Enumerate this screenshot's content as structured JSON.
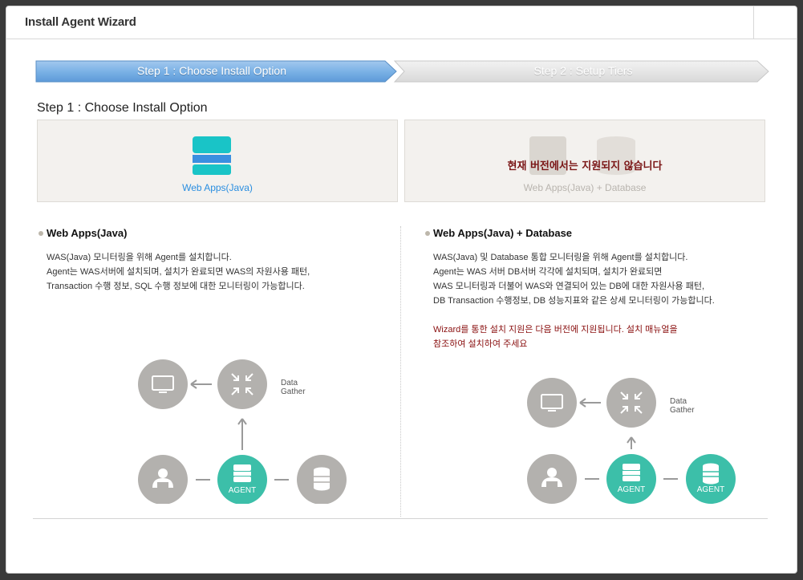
{
  "window": {
    "title": "Install Agent Wizard"
  },
  "steps": [
    {
      "label": "Step 1 : Choose Install Option",
      "state": "active"
    },
    {
      "label": "Step 2 : Setup Tiers",
      "state": "inactive"
    }
  ],
  "section_title": "Step 1 : Choose Install Option",
  "options": [
    {
      "caption": "Web Apps(Java)",
      "icon": "server-stack-icon",
      "selected": true
    },
    {
      "caption": "Web Apps(Java)  + Database",
      "icon": "server-and-database-icon",
      "disabled_message": "현재 버전에서는 지원되지 않습니다"
    }
  ],
  "details": [
    {
      "heading": "Web Apps(Java)",
      "lines": [
        "WAS(Java) 모니터링을 위해 Agent를 설치합니다.",
        "Agent는 WAS서버에 설치되며, 설치가 완료되면 WAS의 자원사용 패턴,",
        "Transaction 수행 정보, SQL 수행 정보에 대한 모니터링이 가능합니다."
      ],
      "diagram": {
        "data_gather": [
          "Data",
          "Gather"
        ],
        "agent": "AGENT"
      }
    },
    {
      "heading": "Web Apps(Java) + Database",
      "lines": [
        "WAS(Java) 및 Database 통합 모니터링을 위해 Agent를 설치합니다.",
        "Agent는 WAS 서버 DB서버 각각에 설치되며, 설치가 완료되면",
        "WAS 모니터링과 더불어 WAS와 연결되어 있는 DB에 대한 자원사용 패턴,",
        "DB Transaction 수행정보, DB 성능지표와 같은 상세 모니터링이 가능합니다."
      ],
      "note": [
        "Wizard를 통한 설치 지원은 다음 버전에 지원됩니다. 설치 매뉴얼을",
        "참조하여 설치하여 주세요"
      ],
      "diagram": {
        "data_gather": [
          "Data",
          "Gather"
        ],
        "agent": "AGENT",
        "agent_db": "AGENT"
      }
    }
  ],
  "colors": {
    "accent": "#2a8ee0",
    "teal": "#3cbfa9",
    "gray_node": "#b3b1ae",
    "warning": "#8a1010",
    "step_active": "#6aa6de"
  }
}
